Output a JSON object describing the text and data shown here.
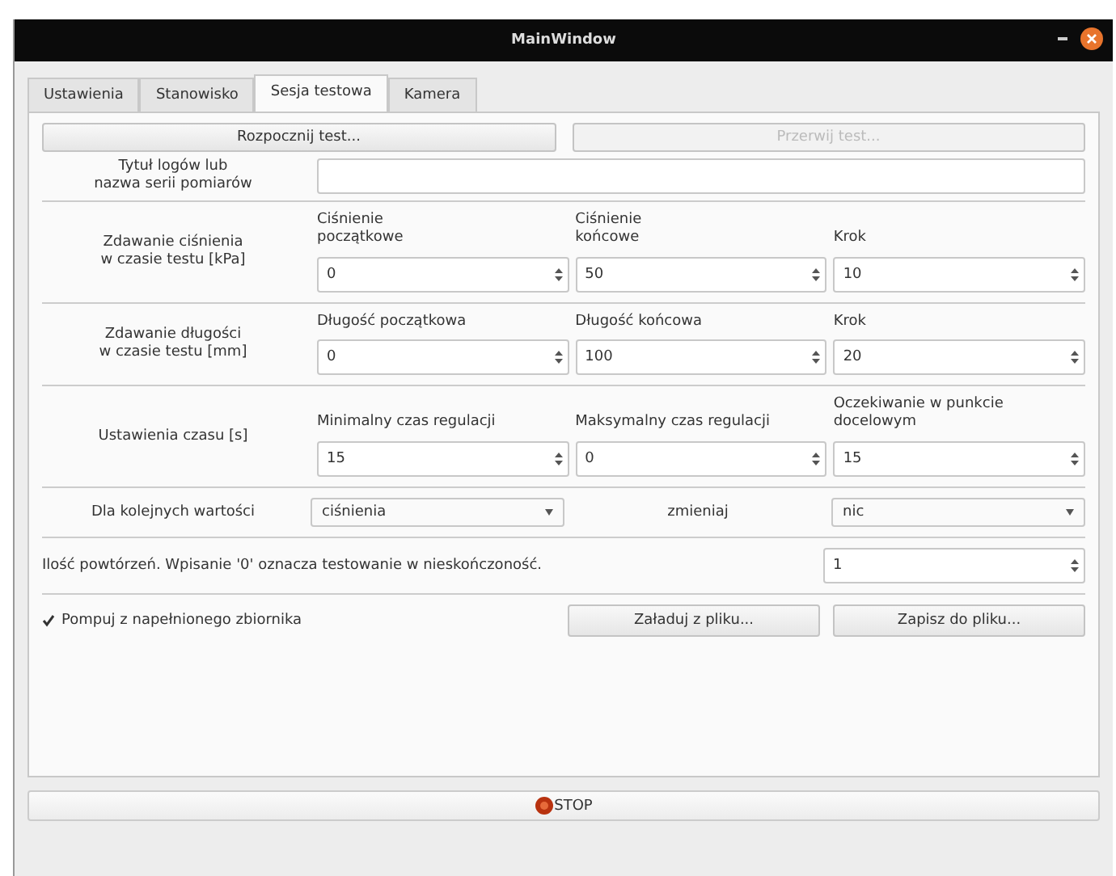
{
  "window": {
    "title": "MainWindow"
  },
  "tabs": [
    {
      "label": "Ustawienia",
      "selected": false
    },
    {
      "label": "Stanowisko",
      "selected": false
    },
    {
      "label": "Sesja testowa",
      "selected": true
    },
    {
      "label": "Kamera",
      "selected": false
    }
  ],
  "action_buttons": [
    {
      "label": "Rozpocznij test...",
      "disabled": false
    },
    {
      "label": "Przerwij test...",
      "disabled": true
    }
  ],
  "log_title": {
    "label": "Tytuł logów lub\nnazwa serii pomiarów"
  },
  "sections": [
    {
      "label": "Zdawanie ciśnienia\nw czasie testu [kPa]",
      "fields": [
        {
          "label": "Ciśnienie\npoczątkowe",
          "value": "0"
        },
        {
          "label": "Ciśnienie\nkońcowe",
          "value": "50"
        },
        {
          "label": "Krok",
          "value": "10"
        }
      ]
    },
    {
      "label": "Zdawanie długości\nw czasie testu [mm]",
      "fields": [
        {
          "label": "Długość początkowa",
          "value": "0"
        },
        {
          "label": "Długość końcowa",
          "value": "100"
        },
        {
          "label": "Krok",
          "value": "20"
        }
      ]
    },
    {
      "label": "Ustawienia czasu [s]",
      "fields": [
        {
          "label": "Minimalny czas regulacji",
          "value": "15"
        },
        {
          "label": "Maksymalny czas regulacji",
          "value": "0"
        },
        {
          "label": "Oczekiwanie w punkcie\ndocelowym",
          "value": "15"
        }
      ]
    }
  ],
  "series_row": {
    "label": "Dla kolejnych wartości",
    "first_combo": "ciśnienia",
    "middle_label": "zmieniaj",
    "second_combo": "nic"
  },
  "repeats": {
    "label": "Ilość powtórzeń. Wpisanie '0' oznacza testowanie w nieskończoność.",
    "value": "1"
  },
  "pump_checkbox": {
    "label": "Pompuj z napełnionego zbiornika",
    "checked": true
  },
  "file_buttons": [
    "Załaduj z pliku...",
    "Zapisz do pliku..."
  ],
  "stop_button": {
    "label": "STOP"
  }
}
